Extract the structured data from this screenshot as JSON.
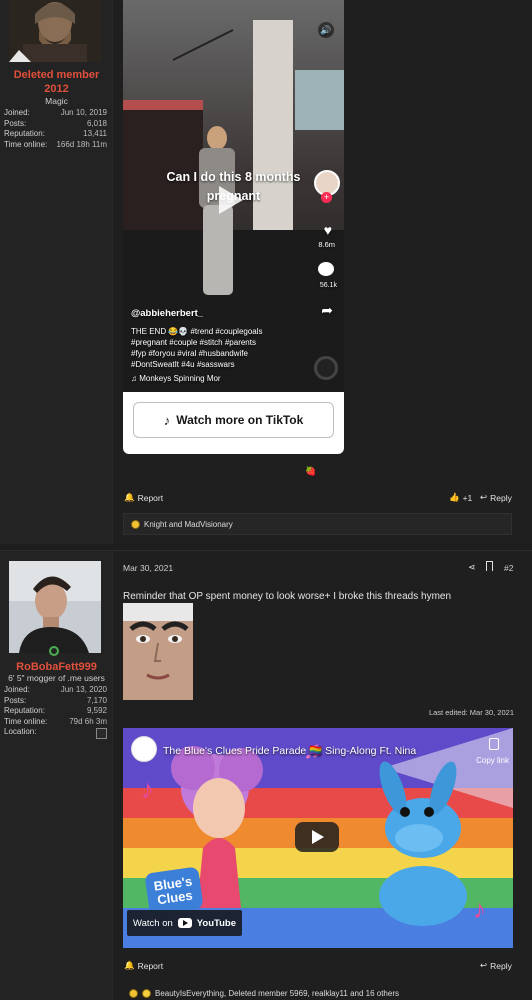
{
  "post1": {
    "user": {
      "name": "Deleted member 2012",
      "title": "Magic",
      "stats": [
        {
          "label": "Joined:",
          "value": "Jun 10, 2019"
        },
        {
          "label": "Posts:",
          "value": "6,018"
        },
        {
          "label": "Reputation:",
          "value": "13,411"
        },
        {
          "label": "Time online:",
          "value": "166d 18h 11m"
        }
      ]
    },
    "tiktok": {
      "caption_line1": "Can I do this 8 months",
      "caption_line2": "pregnant",
      "handle": "@abbieherbert_",
      "desc_line1": "THE END 😂💀 #trend #couplegoals",
      "desc_line2": "#pregnant #couple #stitch #parents",
      "desc_line3": "#fyp #foryou #viral #husbandwife",
      "desc_line4": "#DontSweatIt #4u #sasswars",
      "sound": "♫ Monkeys Spinning Mor",
      "likes": "8.6m",
      "comments": "56.1k",
      "watch_more": "Watch more on TikTok"
    },
    "actions": {
      "report": "Report",
      "plus": "+1",
      "reply": "Reply"
    },
    "reactions": "Knight and MadVisionary"
  },
  "post2": {
    "user": {
      "name": "RoBobaFett999",
      "title": "6' 5\" mogger of .me users",
      "stats": [
        {
          "label": "Joined:",
          "value": "Jun 13, 2020"
        },
        {
          "label": "Posts:",
          "value": "7,170"
        },
        {
          "label": "Reputation:",
          "value": "9,592"
        },
        {
          "label": "Time online:",
          "value": "79d 6h 3m"
        },
        {
          "label": "Location:",
          "value": ""
        }
      ]
    },
    "date": "Mar 30, 2021",
    "post_number": "#2",
    "body": "Reminder that OP spent money to look worse+ I broke this threads hymen",
    "last_edited": "Last edited: Mar 30, 2021",
    "youtube": {
      "title": "The Blue's Clues Pride Parade 🏳️‍🌈 Sing-Along Ft. Nina",
      "copy_link": "Copy link",
      "watch_on": "Watch on",
      "brand": "YouTube",
      "logo_text1": "Blue's",
      "logo_text2": "Clues"
    },
    "actions": {
      "report": "Report",
      "reply": "Reply"
    },
    "reactions": "BeautyIsEverything, Deleted member 5969, realklay11 and 16 others"
  },
  "colors": {
    "username": "#e0503c",
    "background": "#1f1f1f",
    "online": "#4caf50"
  }
}
